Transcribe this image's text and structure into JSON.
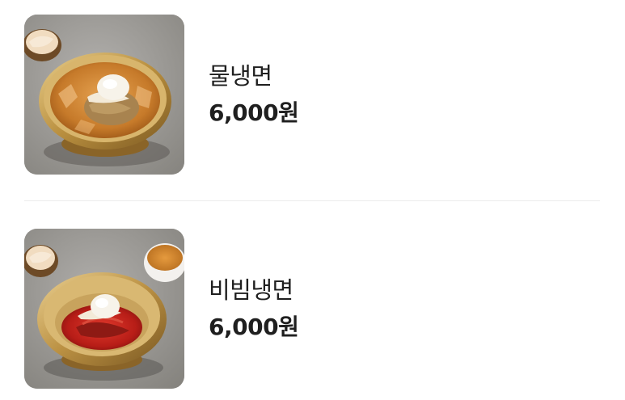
{
  "menu": {
    "items": [
      {
        "name": "물냉면",
        "price": "6,000원",
        "image_icon": "mul-naengmyeon-photo",
        "broth_color": "#c8822f"
      },
      {
        "name": "비빔냉면",
        "price": "6,000원",
        "image_icon": "bibim-naengmyeon-photo",
        "sauce_color": "#c2231c"
      }
    ]
  },
  "colors": {
    "background": "#ffffff",
    "text": "#1f1f1f",
    "divider": "#ececec",
    "brass": "#c9a45a"
  }
}
